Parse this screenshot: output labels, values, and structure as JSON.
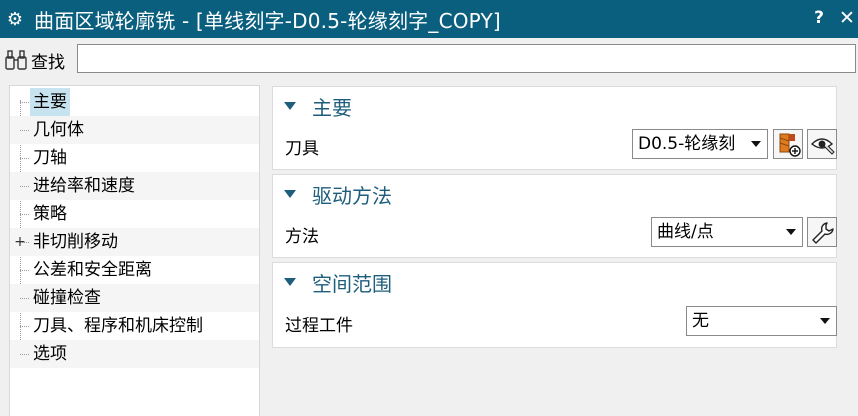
{
  "window": {
    "title": "曲面区域轮廓铣 - [单线刻字-D0.5-轮缘刻字_COPY]",
    "settings_icon": "gear-icon",
    "help_label": "?",
    "close_label": "✕"
  },
  "search": {
    "icon": "binoculars-icon",
    "label": "查找",
    "value": ""
  },
  "tree": {
    "items": [
      {
        "label": "主要",
        "selected": true
      },
      {
        "label": "几何体"
      },
      {
        "label": "刀轴"
      },
      {
        "label": "进给率和速度"
      },
      {
        "label": "策略"
      },
      {
        "label": "非切削移动",
        "expander": "+"
      },
      {
        "label": "公差和安全距离"
      },
      {
        "label": "碰撞检查"
      },
      {
        "label": "刀具、程序和机床控制"
      },
      {
        "label": "选项"
      }
    ]
  },
  "sections": {
    "main": {
      "title": "主要",
      "tool_label": "刀具",
      "tool_value": "D0.5-轮缘刻",
      "new_tool_icon": "new-tool-icon",
      "display_tool_icon": "display-tool-icon"
    },
    "drive": {
      "title": "驱动方法",
      "method_label": "方法",
      "method_value": "曲线/点",
      "edit_icon": "wrench-icon"
    },
    "space": {
      "title": "空间范围",
      "ipw_label": "过程工件",
      "ipw_value": "无"
    }
  },
  "colors": {
    "titlebar": "#0b5f7e",
    "section_title": "#1d5e7c",
    "selection": "#c7e3ef"
  }
}
